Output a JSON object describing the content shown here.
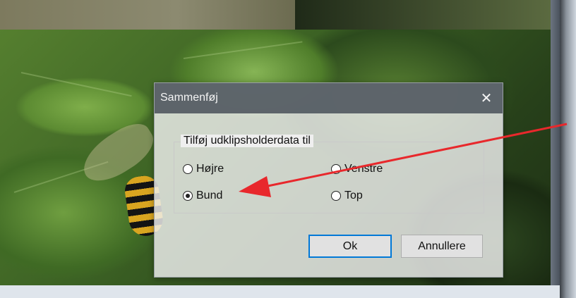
{
  "dialog": {
    "title": "Sammenføj",
    "close_icon": "close-icon",
    "group_label": "Tilføj udklipsholderdata til",
    "options": [
      {
        "label": "Højre",
        "checked": false
      },
      {
        "label": "Venstre",
        "checked": false
      },
      {
        "label": "Bund",
        "checked": true
      },
      {
        "label": "Top",
        "checked": false
      }
    ],
    "ok_label": "Ok",
    "cancel_label": "Annullere"
  },
  "colors": {
    "arrow": "#e8282c",
    "titlebar": "#525a62",
    "primary_border": "#0078d7"
  }
}
